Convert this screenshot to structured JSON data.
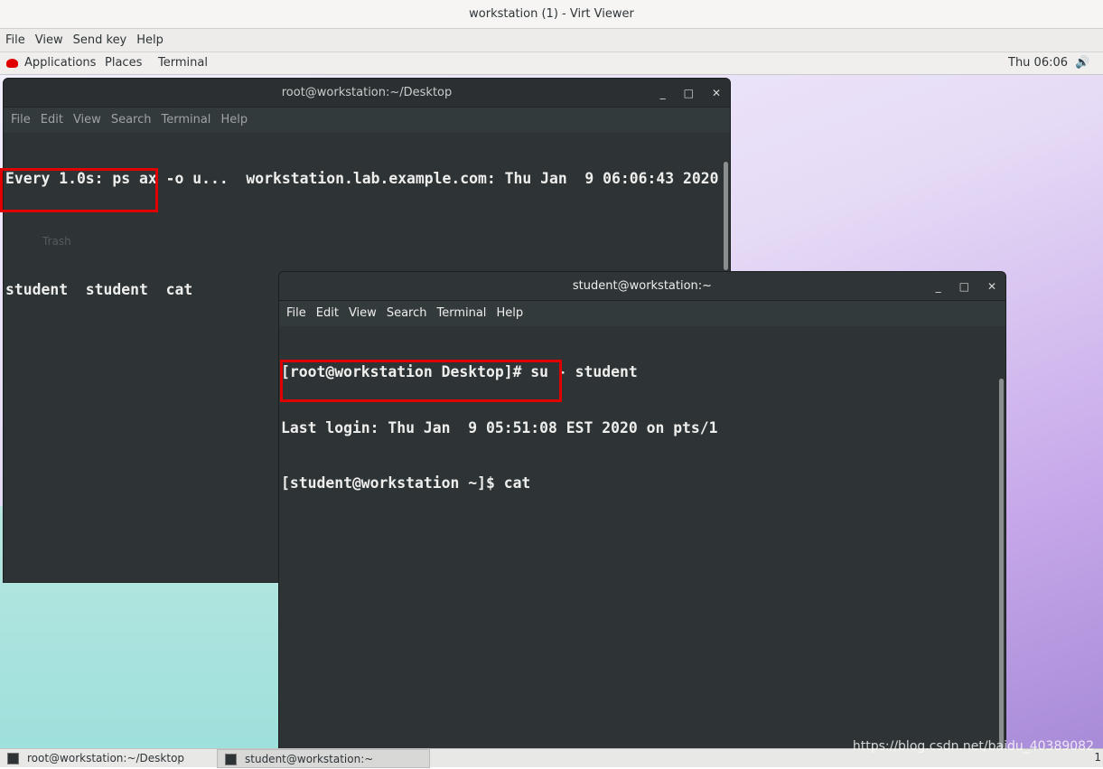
{
  "window": {
    "title": "workstation (1) - Virt Viewer"
  },
  "viewer_menu": [
    "File",
    "View",
    "Send key",
    "Help"
  ],
  "topbar": {
    "items": [
      "Applications",
      "Places",
      "Terminal"
    ],
    "clock": "Thu 06:06",
    "accent": "#e00000"
  },
  "desktop": {
    "trash_label": "Trash"
  },
  "term1": {
    "title": "root@workstation:~/Desktop",
    "menu": [
      "File",
      "Edit",
      "View",
      "Search",
      "Terminal",
      "Help"
    ],
    "lines": [
      "Every 1.0s: ps ax -o u...  workstation.lab.example.com: Thu Jan  9 06:06:43 2020",
      "",
      "student  student  cat"
    ]
  },
  "term2": {
    "title": "student@workstation:~",
    "menu": [
      "File",
      "Edit",
      "View",
      "Search",
      "Terminal",
      "Help"
    ],
    "lines": [
      "[root@workstation Desktop]# su - student",
      "Last login: Thu Jan  9 05:51:08 EST 2020 on pts/1",
      "[student@workstation ~]$ cat"
    ]
  },
  "taskbar": {
    "items": [
      "root@workstation:~/Desktop",
      "student@workstation:~"
    ],
    "page": "1"
  },
  "watermark": "https://blog.csdn.net/baidu_40389082"
}
